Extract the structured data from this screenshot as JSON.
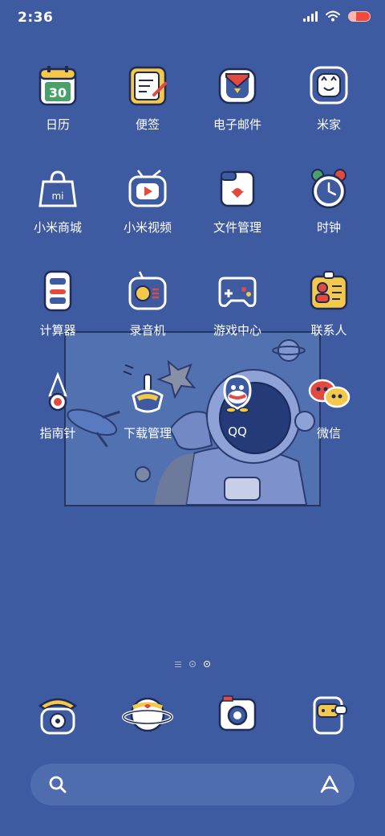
{
  "status_bar": {
    "time": "2:36"
  },
  "apps": [
    {
      "label": "日历",
      "icon": "calendar-icon",
      "day": "30"
    },
    {
      "label": "便签",
      "icon": "notes-icon"
    },
    {
      "label": "电子邮件",
      "icon": "email-icon"
    },
    {
      "label": "米家",
      "icon": "mijia-icon"
    },
    {
      "label": "小米商城",
      "icon": "mi-store-icon"
    },
    {
      "label": "小米视频",
      "icon": "mi-video-icon"
    },
    {
      "label": "文件管理",
      "icon": "file-manager-icon"
    },
    {
      "label": "时钟",
      "icon": "clock-icon"
    },
    {
      "label": "计算器",
      "icon": "calculator-icon"
    },
    {
      "label": "录音机",
      "icon": "recorder-icon"
    },
    {
      "label": "游戏中心",
      "icon": "game-center-icon"
    },
    {
      "label": "联系人",
      "icon": "contacts-icon"
    },
    {
      "label": "指南针",
      "icon": "compass-icon"
    },
    {
      "label": "下载管理",
      "icon": "downloads-icon"
    },
    {
      "label": "QQ",
      "icon": "qq-icon"
    },
    {
      "label": "微信",
      "icon": "wechat-icon"
    }
  ],
  "dock": [
    {
      "icon": "phone-icon"
    },
    {
      "icon": "browser-planet-icon"
    },
    {
      "icon": "camera-icon"
    },
    {
      "icon": "messages-icon"
    }
  ],
  "search": {
    "icon": "search-icon",
    "brand_icon": "assistant-icon"
  },
  "pages": {
    "count": 2,
    "active": 2
  },
  "colors": {
    "wallpaper": "#3e5aa1",
    "widget": "#5271b1",
    "accent_yellow": "#f4c84a",
    "accent_red": "#e24a3f"
  }
}
